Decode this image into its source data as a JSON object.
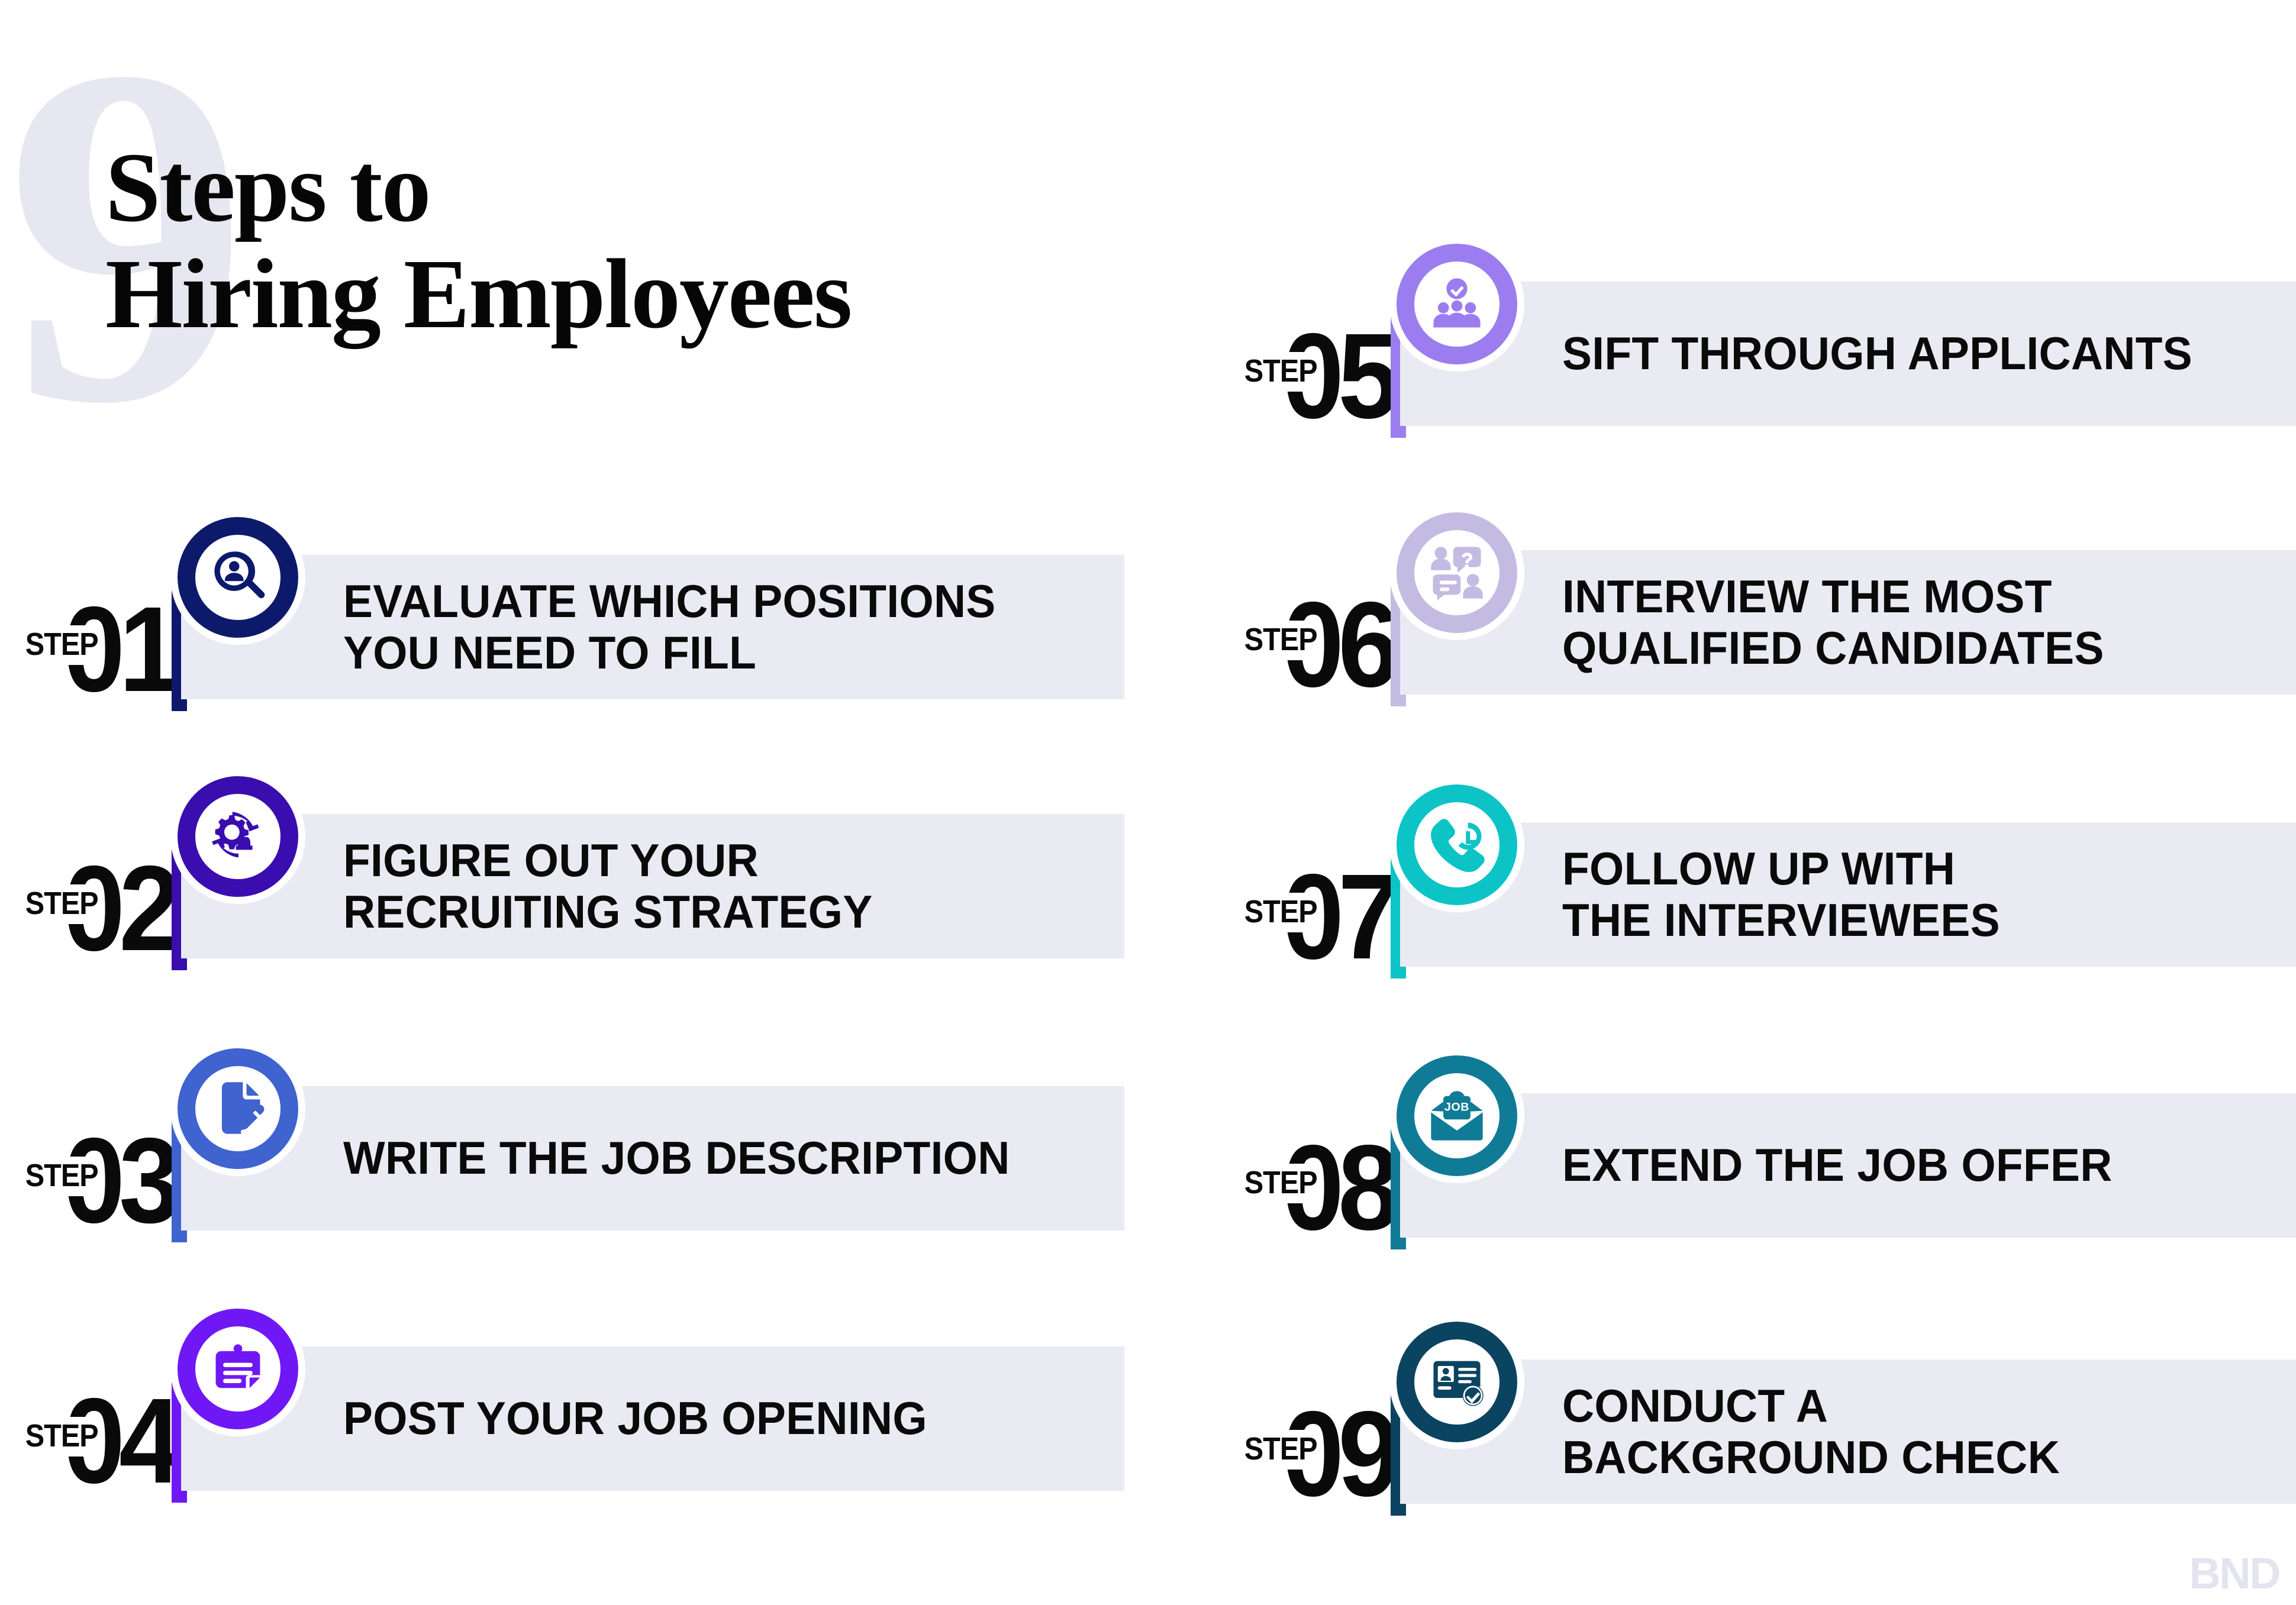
{
  "title": {
    "big_numeral": "9",
    "heading": "Steps to\nHiring Employees"
  },
  "logo": {
    "text": "BND"
  },
  "step_word": "STEP",
  "steps": [
    {
      "number": "01",
      "label": "EVALUATE WHICH POSITIONS\nYOU NEED TO FILL",
      "color": "#0d1a6b",
      "icon": "person-search-icon",
      "column": "left"
    },
    {
      "number": "02",
      "label": "FIGURE OUT YOUR\nRECRUITING STRATEGY",
      "color": "#3a0dae",
      "icon": "gear-strategy-icon",
      "column": "left"
    },
    {
      "number": "03",
      "label": "WRITE THE JOB DESCRIPTION",
      "color": "#3f63cf",
      "icon": "document-pencil-icon",
      "column": "left"
    },
    {
      "number": "04",
      "label": "POST YOUR JOB OPENING",
      "color": "#6f18f5",
      "icon": "job-posting-card-icon",
      "column": "left"
    },
    {
      "number": "05",
      "label": "SIFT THROUGH APPLICANTS",
      "color": "#9b7df0",
      "icon": "people-check-icon",
      "column": "right"
    },
    {
      "number": "06",
      "label": "INTERVIEW THE MOST\nQUALIFIED CANDIDATES",
      "color": "#c4bbe3",
      "icon": "interview-qa-icon",
      "column": "right"
    },
    {
      "number": "07",
      "label": "FOLLOW UP WITH\nTHE INTERVIEWEES",
      "color": "#0cc4c6",
      "icon": "phone-clock-icon",
      "column": "right"
    },
    {
      "number": "08",
      "label": "EXTEND THE JOB OFFER",
      "color": "#107b96",
      "icon": "job-envelope-icon",
      "column": "right"
    },
    {
      "number": "09",
      "label": "CONDUCT A\nBACKGROUND CHECK",
      "color": "#0b4460",
      "icon": "id-card-verified-icon",
      "column": "right"
    }
  ],
  "icon_text": {
    "envelope_job_label": "JOB"
  },
  "palette": {
    "panel_bg": "#eaeaf3",
    "ghost_numeral": "#e7e7f1",
    "text": "#0a0a0a",
    "page_bg": "#ffffff"
  }
}
